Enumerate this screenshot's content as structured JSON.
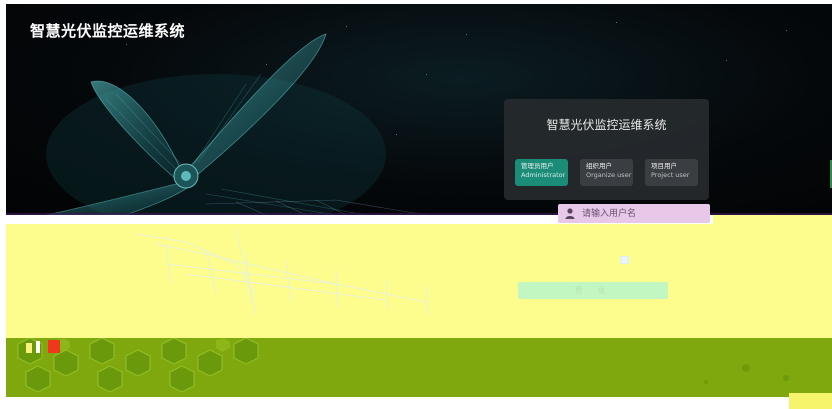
{
  "app": {
    "title": "智慧光伏监控运维系统"
  },
  "login": {
    "title": "智慧光伏监控运维系统",
    "user_types": [
      {
        "cn": "管理员用户",
        "en": "Administrator",
        "active": true
      },
      {
        "cn": "组织用户",
        "en": "Organize user",
        "active": false
      },
      {
        "cn": "项目用户",
        "en": "Project user",
        "active": false
      }
    ],
    "username": {
      "placeholder": "请输入用户名",
      "value": ""
    },
    "submit_label": "登 录"
  },
  "colors": {
    "accent": "#1a8c78",
    "card_bg": "#2a2e32",
    "hero_bg": "#05080b",
    "button_bg": "#c3f7c2",
    "yellow_band": "#fdfd8e",
    "green_band": "#7fa80e"
  },
  "icons": {
    "user_field": "user-icon"
  }
}
